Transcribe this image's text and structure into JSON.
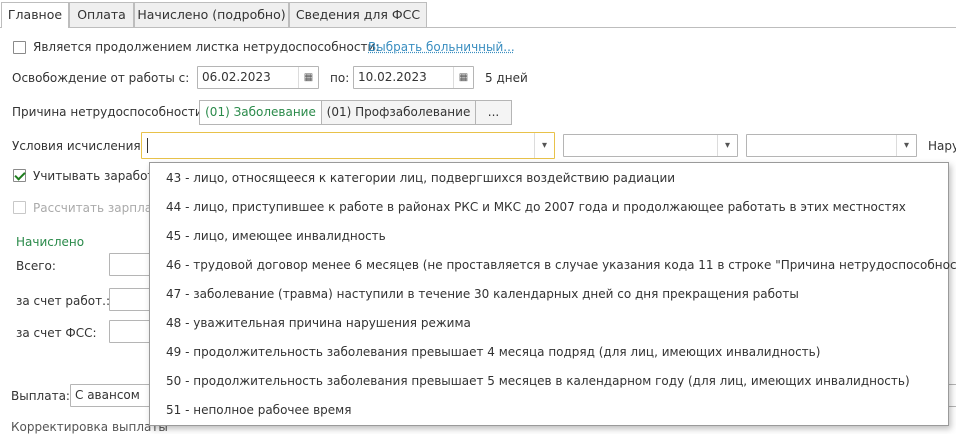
{
  "tabs": [
    {
      "label": "Главное"
    },
    {
      "label": "Оплата"
    },
    {
      "label": "Начислено (подробно)"
    },
    {
      "label": "Сведения для ФСС"
    }
  ],
  "continuation": {
    "label": "Является продолжением листка нетрудоспособности:",
    "link": "Выбрать больничный..."
  },
  "release": {
    "label": "Освобождение от работы с:",
    "from": "06.02.2023",
    "to_label": "по:",
    "to": "10.02.2023",
    "days": "5 дней"
  },
  "reason": {
    "label": "Причина нетрудоспособности:",
    "options": [
      "(01) Заболевание",
      "(01) Профзаболевание",
      "..."
    ]
  },
  "conditions": {
    "label": "Условия исчисления:",
    "value": "",
    "right_cut_label": "Нару"
  },
  "checkboxes": {
    "earnings": "Учитывать заработ",
    "calc": "Рассчитать зарпла"
  },
  "accrued": {
    "title": "Начислено",
    "total": "Всего:",
    "employer": "за счет работ.:",
    "fss": "за счет ФСС:"
  },
  "payout": {
    "label": "Выплата:",
    "value": "С авансом"
  },
  "bottom_cut": "Корректировка выплаты",
  "dropdown_items": [
    "43 - лицо, относящееся к категории лиц, подвергшихся воздействию радиации",
    "44 - лицо, приступившее к работе в районах РКС и МКС до 2007 года и продолжающее работать в этих местностях",
    "45 - лицо, имеющее инвалидность",
    "46 - трудовой договор менее 6 месяцев (не проставляется в случае указания кода 11 в строке \"Причина нетрудоспособности\")",
    "47 - заболевание (травма) наступили в течение 30 календарных дней со дня прекращения работы",
    "48 - уважительная причина нарушения режима",
    "49 - продолжительность заболевания превышает 4 месяца подряд (для лиц, имеющих инвалидность)",
    "50 - продолжительность заболевания превышает 5 месяцев в календарном году (для лиц, имеющих инвалидность)",
    "51 - неполное рабочее время"
  ],
  "colors": {
    "link": "#3a8ec0",
    "accent_green": "#2a8a4a",
    "focus_border": "#e8c24a"
  }
}
